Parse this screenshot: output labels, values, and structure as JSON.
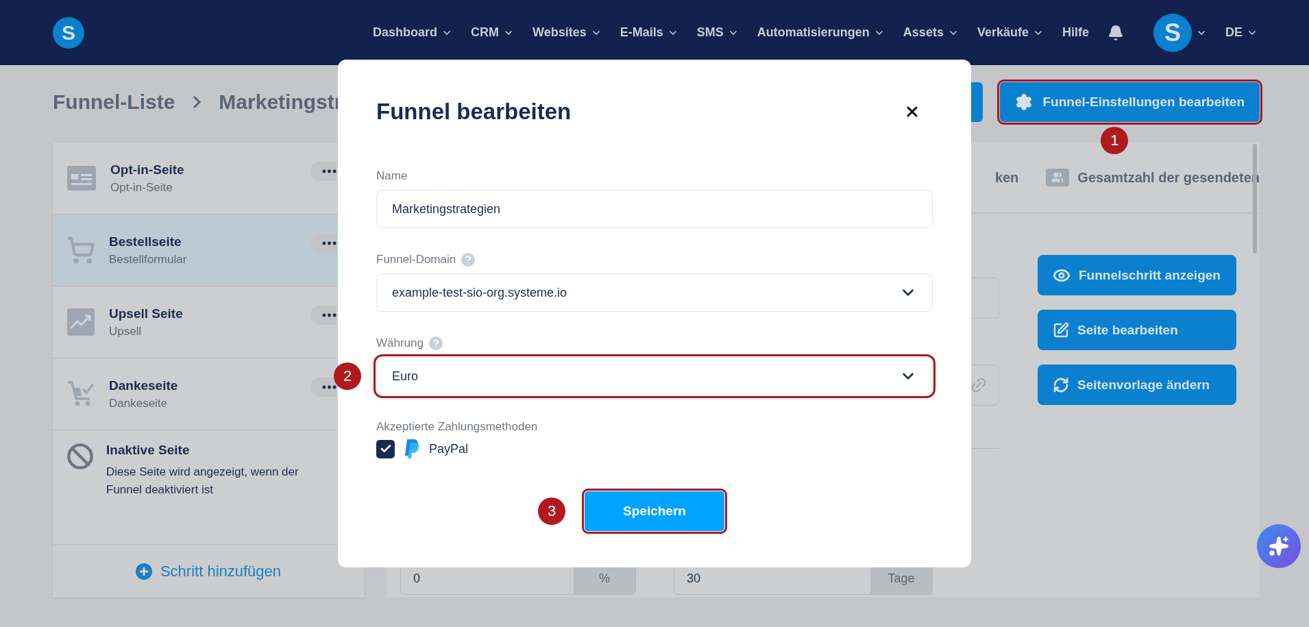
{
  "nav": {
    "logo": "S",
    "items": [
      {
        "label": "Dashboard",
        "dropdown": true
      },
      {
        "label": "CRM",
        "dropdown": true
      },
      {
        "label": "Websites",
        "dropdown": true
      },
      {
        "label": "E-Mails",
        "dropdown": true
      },
      {
        "label": "SMS",
        "dropdown": true
      },
      {
        "label": "Automatisierungen",
        "dropdown": true
      },
      {
        "label": "Assets",
        "dropdown": true
      },
      {
        "label": "Verkäufe",
        "dropdown": true
      },
      {
        "label": "Hilfe",
        "dropdown": false
      }
    ],
    "avatar": "S",
    "language": "DE"
  },
  "breadcrumb": [
    "Funnel-Liste",
    "Marketingstr"
  ],
  "header_button": {
    "label": "Funnel-Einstellungen bearbeiten",
    "highlighted": true,
    "marker": "1"
  },
  "steps": [
    {
      "title": "Opt-in-Seite",
      "subtitle": "Opt-in-Seite",
      "selected": false
    },
    {
      "title": "Bestellseite",
      "subtitle": "Bestellformular",
      "selected": true
    },
    {
      "title": "Upsell Seite",
      "subtitle": "Upsell",
      "selected": false
    },
    {
      "title": "Dankeseite",
      "subtitle": "Dankeseite",
      "selected": false
    }
  ],
  "inactive_page": {
    "title": "Inaktive Seite",
    "description": "Diese Seite wird angezeigt, wenn der Funnel deaktiviert ist"
  },
  "add_step": "Schritt hinzufügen",
  "tabs": [
    {
      "label": "ken"
    },
    {
      "label": "Gesamtzahl der gesendeten"
    }
  ],
  "step_actions": [
    {
      "label": "Funnelschritt anzeigen"
    },
    {
      "label": "Seite bearbeiten"
    },
    {
      "label": "Seitenvorlage ändern"
    }
  ],
  "settings_fields": [
    {
      "value": "0",
      "suffix": "%"
    },
    {
      "value": "30",
      "suffix": "Tage"
    }
  ],
  "modal": {
    "title": "Funnel bearbeiten",
    "fields": [
      {
        "kind": "text",
        "label": "Name",
        "value": "Marketingstrategien",
        "help": false,
        "highlighted": false
      },
      {
        "kind": "select",
        "label": "Funnel-Domain",
        "value": "example-test-sio-org.systeme.io",
        "help": true,
        "highlighted": false
      },
      {
        "kind": "select",
        "label": "Währung",
        "value": "Euro",
        "help": true,
        "highlighted": true,
        "marker": "2"
      }
    ],
    "payment_label": "Akzeptierte Zahlungsmethoden",
    "payment_methods": [
      {
        "label": "PayPal",
        "checked": true
      }
    ],
    "save_button": {
      "label": "Speichern",
      "highlighted": true,
      "marker": "3"
    }
  }
}
